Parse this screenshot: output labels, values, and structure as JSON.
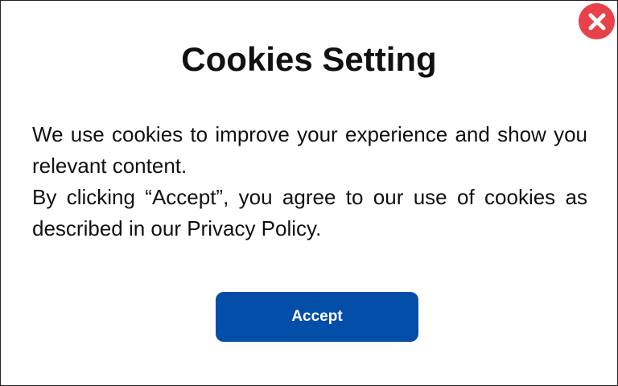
{
  "dialog": {
    "title": "Cookies Setting",
    "paragraphs": [
      "We use cookies to improve your experience and show you relevant content.",
      "By clicking “Accept”, you agree to our use of cookies as described in our Privacy Policy."
    ],
    "accept_label": "Accept",
    "close_icon": "close-icon"
  },
  "colors": {
    "accent": "#034ea9",
    "close": "#e8414a",
    "text": "#111111",
    "background": "#ffffff"
  }
}
